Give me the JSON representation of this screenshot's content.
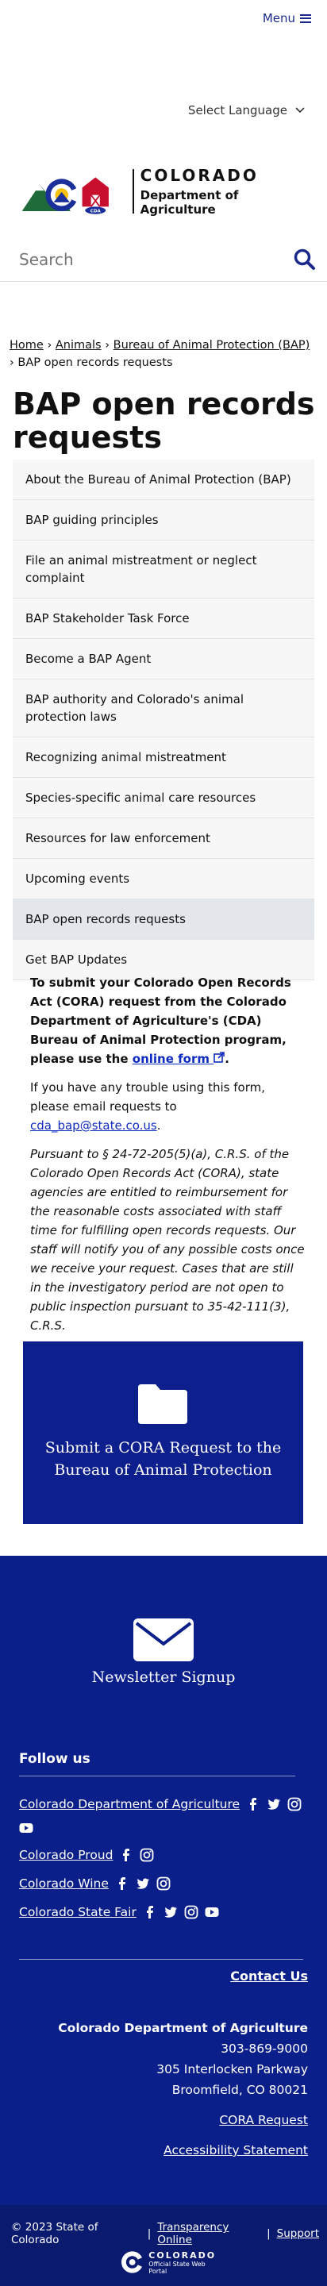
{
  "header": {
    "menu_label": "Menu",
    "language_label": "Select Language",
    "logo_title": "COLORADO",
    "logo_subtitle": "Department of Agriculture",
    "logo_badge": "CDA",
    "search_placeholder": "Search"
  },
  "breadcrumb": {
    "items": [
      "Home",
      "Animals",
      "Bureau of Animal Protection (BAP)",
      "BAP open records requests"
    ],
    "separator": "›"
  },
  "page_title": "BAP open records requests",
  "nav": {
    "items": [
      "About the Bureau of Animal Protection (BAP)",
      "BAP guiding principles",
      "File an animal mistreatment or neglect complaint",
      "BAP Stakeholder Task Force",
      "Become a BAP Agent",
      "BAP authority and Colorado's animal protection laws",
      "Recognizing animal mistreatment",
      "Species-specific animal care resources",
      "Resources for law enforcement",
      "Upcoming events",
      "BAP open records requests",
      "Get BAP Updates"
    ],
    "active_index": 10
  },
  "body": {
    "intro": "To submit your Colorado Open Records Act (CORA) request from the Colorado Department of Agriculture's (CDA) Bureau of Animal Protection program, please use the",
    "intro_link": "online form",
    "trouble_prefix": "If you have any trouble using this form, please email requests to",
    "email": "cda_bap@state.co.us",
    "statute": "Pursuant to § 24-72-205(5)(a), C.R.S. of the Colorado Open Records Act (CORA), state agencies are entitled to reimbursement for the reasonable costs associated with staff time for fulfilling open records requests. Our staff will notify you of any possible costs once we receive your request. Cases that are still in the investigatory period are not open to public inspection pursuant to 35-42-111(3), C.R.S."
  },
  "cora_card": {
    "label": "Submit a CORA Request to the Bureau of Animal Protection",
    "icon": "folder-icon"
  },
  "footer": {
    "newsletter_label": "Newsletter Signup",
    "follow_heading": "Follow us",
    "social": [
      {
        "name": "Colorado Department of Agriculture",
        "icons": [
          "facebook-icon",
          "twitter-icon",
          "instagram-icon",
          "youtube-icon"
        ]
      },
      {
        "name": "Colorado Proud",
        "icons": [
          "facebook-icon",
          "instagram-icon"
        ]
      },
      {
        "name": "Colorado Wine",
        "icons": [
          "facebook-icon",
          "twitter-icon",
          "instagram-icon"
        ]
      },
      {
        "name": "Colorado State Fair",
        "icons": [
          "facebook-icon",
          "twitter-icon",
          "instagram-icon",
          "youtube-icon"
        ]
      }
    ],
    "contact_label": "Contact Us",
    "dept_name": "Colorado Department of Agriculture",
    "phone": "303-869-9000",
    "address1": "305 Interlocken Parkway",
    "address2": "Broomfield, CO 80021",
    "cora_link": "CORA Request",
    "accessibility_link": "Accessibility Statement"
  },
  "bottom": {
    "copyright": "© 2023 State of Colorado",
    "transparency": "Transparency Online",
    "support": "Support",
    "state_logo_title": "COLORADO",
    "state_logo_subtitle": "Official State Web Portal"
  },
  "colors": {
    "primary_blue": "#0b1f8a",
    "link_blue": "#0f2bbf",
    "nav_bg": "#f7f7f7",
    "nav_active": "#e3e6ea"
  }
}
